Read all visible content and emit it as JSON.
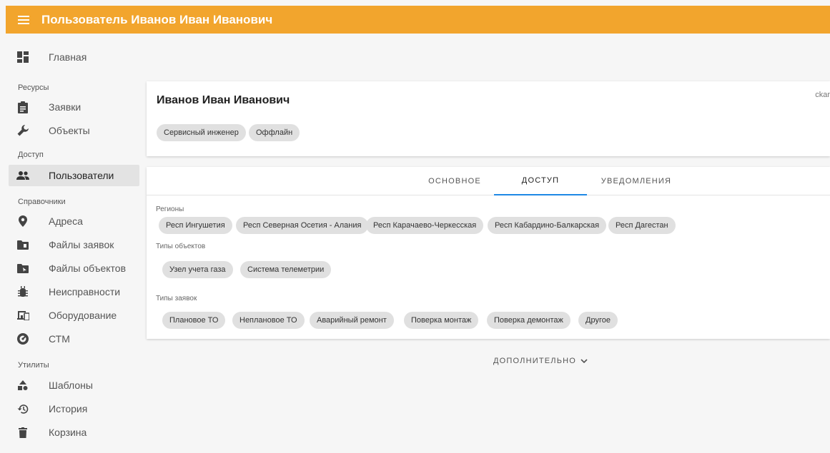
{
  "topbar": {
    "title": "Пользователь Иванов Иван Иванович",
    "menu_icon": "hamburger-icon",
    "color": "#f2a52d"
  },
  "sidebar": {
    "home": {
      "label": "Главная",
      "icon": "dashboard-icon"
    },
    "sections": {
      "resources": "Ресурсы",
      "access": "Доступ",
      "directories": "Справочники",
      "utilities": "Утилиты"
    },
    "items": {
      "requests": {
        "label": "Заявки",
        "icon": "clipboard-icon"
      },
      "objects": {
        "label": "Объекты",
        "icon": "wrench-icon"
      },
      "users": {
        "label": "Пользователи",
        "icon": "people-icon"
      },
      "addresses": {
        "label": "Адреса",
        "icon": "location-pin-icon"
      },
      "request_files": {
        "label": "Файлы заявок",
        "icon": "folder-icon"
      },
      "object_files": {
        "label": "Файлы объектов",
        "icon": "folder-shared-icon"
      },
      "faults": {
        "label": "Неисправности",
        "icon": "bug-icon"
      },
      "equipment": {
        "label": "Оборудование",
        "icon": "devices-icon"
      },
      "ctm": {
        "label": "СТМ",
        "icon": "gauge-icon"
      },
      "templates": {
        "label": "Шаблоны",
        "icon": "shapes-icon"
      },
      "history": {
        "label": "История",
        "icon": "history-icon"
      },
      "trash": {
        "label": "Корзина",
        "icon": "trash-icon"
      }
    }
  },
  "profile": {
    "name": "Иванов Иван Иванович",
    "corner_text": "ckar",
    "chips": [
      "Сервисный инженер",
      "Оффлайн"
    ]
  },
  "tabs": {
    "main": "ОСНОВНОЕ",
    "access": "ДОСТУП",
    "notifications": "УВЕДОМЛЕНИЯ",
    "active_color": "#1e88e5"
  },
  "access": {
    "regions_label": "Регионы",
    "regions": [
      "Респ Ингушетия",
      "Респ Северная Осетия - Алания",
      "Респ Карачаево-Черкесская",
      "Респ Кабардино-Балкарская",
      "Респ Дагестан"
    ],
    "object_types_label": "Типы объектов",
    "object_types": [
      "Узел учета газа",
      "Система телеметрии"
    ],
    "request_types_label": "Типы заявок",
    "request_types": [
      "Плановое ТО",
      "Неплановое ТО",
      "Аварийный ремонт",
      "Поверка монтаж",
      "Поверка демонтаж",
      "Другое"
    ]
  },
  "more": {
    "label": "ДОПОЛНИТЕЛЬНО",
    "icon": "chevron-down-icon"
  }
}
